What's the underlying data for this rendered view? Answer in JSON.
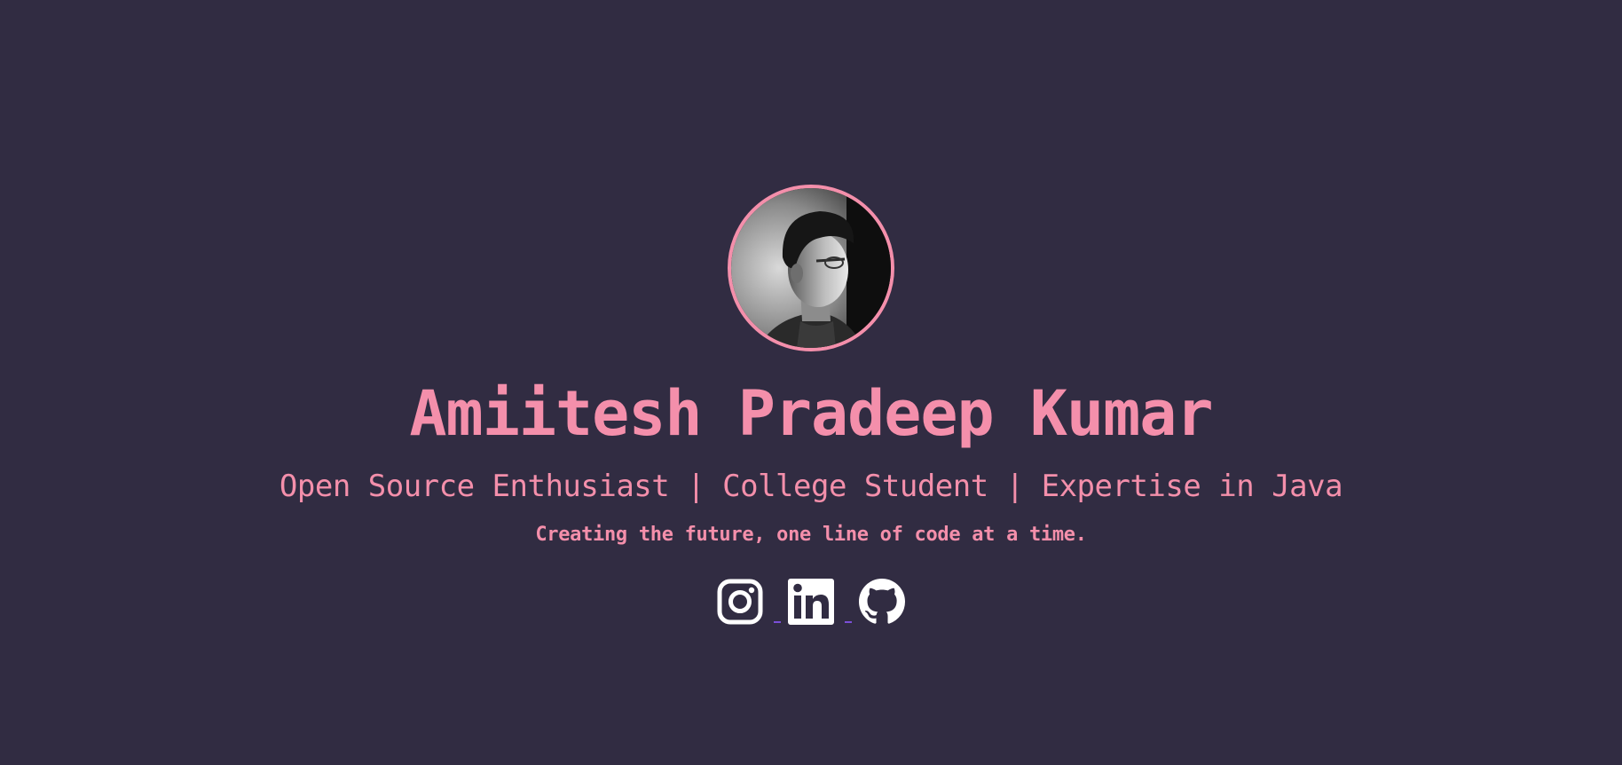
{
  "profile": {
    "avatar_alt": "profile photo",
    "name": "Amiitesh Pradeep Kumar",
    "tagline": "Open Source Enthusiast | College Student | Expertise in Java",
    "motto": "Creating the future, one line of code at a time."
  },
  "socials": [
    {
      "icon": "instagram-icon"
    },
    {
      "icon": "linkedin-icon"
    },
    {
      "icon": "github-icon"
    }
  ],
  "colors": {
    "background": "#312c42",
    "accent": "#f48fab",
    "icon": "#ffffff",
    "link_underline": "#7a4fd8"
  }
}
